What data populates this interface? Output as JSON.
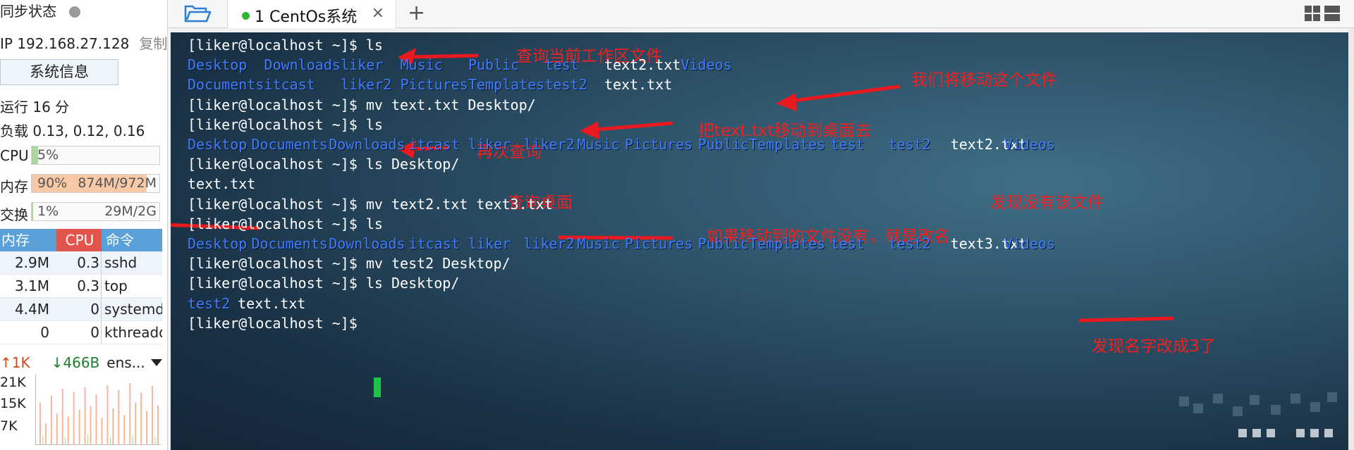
{
  "sidebar": {
    "sync_label": "同步状态",
    "ip_label": "IP 192.168.27.128",
    "copy_label": "复制",
    "sysinfo_button": "系统信息",
    "uptime": "运行 16 分",
    "load": "负载 0.13, 0.12, 0.16",
    "cpu": {
      "label": "CPU",
      "value": "5%",
      "fraction": 0.05
    },
    "memory": {
      "label": "内存",
      "value": "90%",
      "detail": "874M/972M",
      "fraction": 0.9
    },
    "swap": {
      "label": "交换",
      "value": "1%",
      "detail": "29M/2G",
      "fraction": 0.01
    },
    "process_table": {
      "headers": {
        "mem": "内存",
        "cpu": "CPU",
        "cmd": "命令"
      },
      "rows": [
        {
          "mem": "2.9M",
          "cpu": "0.3",
          "cmd": "sshd"
        },
        {
          "mem": "3.1M",
          "cpu": "0.3",
          "cmd": "top"
        },
        {
          "mem": "4.4M",
          "cpu": "0",
          "cmd": "systemd"
        },
        {
          "mem": "0",
          "cpu": "0",
          "cmd": "kthreadd"
        }
      ]
    },
    "network": {
      "up": "↑1K",
      "down": "↓466B",
      "interface": "ens...",
      "axis": [
        "21K",
        "15K",
        "7K"
      ]
    }
  },
  "tabs": {
    "active_label": "1 CentOs系统",
    "close_symbol": "×",
    "new_tab_symbol": "+"
  },
  "terminal": {
    "prompt": "[liker@localhost ~]$",
    "lines": [
      {
        "type": "cmd",
        "text": "[liker@localhost ~]$ ls"
      },
      {
        "type": "listing",
        "tokens": [
          {
            "t": "Desktop",
            "k": "dir"
          },
          {
            "t": "Downloads",
            "k": "dir"
          },
          {
            "t": "liker",
            "k": "dir"
          },
          {
            "t": "Music",
            "k": "dir"
          },
          {
            "t": "Public",
            "k": "dir"
          },
          {
            "t": "test",
            "k": "dir"
          },
          {
            "t": "text2.txt",
            "k": "file"
          },
          {
            "t": "Videos",
            "k": "dir"
          }
        ]
      },
      {
        "type": "listing",
        "tokens": [
          {
            "t": "Documents",
            "k": "dir"
          },
          {
            "t": "itcast",
            "k": "dir"
          },
          {
            "t": "liker2",
            "k": "dir"
          },
          {
            "t": "Pictures",
            "k": "dir"
          },
          {
            "t": "Templates",
            "k": "dir"
          },
          {
            "t": "test2",
            "k": "dir"
          },
          {
            "t": "text.txt",
            "k": "file"
          }
        ]
      },
      {
        "type": "cmd",
        "text": "[liker@localhost ~]$ mv text.txt Desktop/"
      },
      {
        "type": "cmd",
        "text": "[liker@localhost ~]$ ls"
      },
      {
        "type": "listing",
        "tokens": [
          {
            "t": "Desktop",
            "k": "dir"
          },
          {
            "t": "Documents",
            "k": "dir"
          },
          {
            "t": "Downloads",
            "k": "dir"
          },
          {
            "t": "itcast",
            "k": "dir"
          },
          {
            "t": "liker",
            "k": "dir"
          },
          {
            "t": "liker2",
            "k": "dir"
          },
          {
            "t": "Music",
            "k": "dir"
          },
          {
            "t": "Pictures",
            "k": "dir"
          },
          {
            "t": "Public",
            "k": "dir"
          },
          {
            "t": "Templates",
            "k": "dir"
          },
          {
            "t": "test",
            "k": "dir"
          },
          {
            "t": "test2",
            "k": "dir"
          },
          {
            "t": "text2.txt",
            "k": "file"
          },
          {
            "t": "Videos",
            "k": "dir"
          }
        ]
      },
      {
        "type": "cmd",
        "text": "[liker@localhost ~]$ ls Desktop/"
      },
      {
        "type": "listing",
        "tokens": [
          {
            "t": "text.txt",
            "k": "file"
          }
        ]
      },
      {
        "type": "cmd",
        "text": "[liker@localhost ~]$ mv text2.txt text3.txt"
      },
      {
        "type": "cmd",
        "text": "[liker@localhost ~]$ ls"
      },
      {
        "type": "listing",
        "tokens": [
          {
            "t": "Desktop",
            "k": "dir"
          },
          {
            "t": "Documents",
            "k": "dir"
          },
          {
            "t": "Downloads",
            "k": "dir"
          },
          {
            "t": "itcast",
            "k": "dir"
          },
          {
            "t": "liker",
            "k": "dir"
          },
          {
            "t": "liker2",
            "k": "dir"
          },
          {
            "t": "Music",
            "k": "dir"
          },
          {
            "t": "Pictures",
            "k": "dir"
          },
          {
            "t": "Public",
            "k": "dir"
          },
          {
            "t": "Templates",
            "k": "dir"
          },
          {
            "t": "test",
            "k": "dir"
          },
          {
            "t": "test2",
            "k": "dir"
          },
          {
            "t": "text3.txt",
            "k": "file"
          },
          {
            "t": "Videos",
            "k": "dir"
          }
        ]
      },
      {
        "type": "cmd",
        "text": "[liker@localhost ~]$ mv test2 Desktop/"
      },
      {
        "type": "cmd",
        "text": "[liker@localhost ~]$ ls Desktop/"
      },
      {
        "type": "listing",
        "tokens": [
          {
            "t": "test2",
            "k": "dir"
          },
          {
            "t": "text.txt",
            "k": "file"
          }
        ]
      },
      {
        "type": "cmd",
        "text": "[liker@localhost ~]$ "
      }
    ]
  },
  "annotations": {
    "query_workspace": "查询当前工作区文件",
    "move_this_file": "我们将移动这个文件",
    "move_to_desktop": "把text.txt移动到桌面去",
    "query_again": "再次查询",
    "query_desktop": "查询桌面",
    "file_missing": "发现没有该文件",
    "rename_note": "如果移动到的文件没有，就是改名",
    "renamed_to_3": "发现名字改成3了"
  },
  "colors": {
    "directory": "#3f7cff",
    "file": "#ffffff",
    "annotation": "#ef2020",
    "cursor": "#1ec24c",
    "cpu_meter": "#a8d89a",
    "mem_meter": "#f7c9a6",
    "swap_meter": "#a8d89a"
  }
}
